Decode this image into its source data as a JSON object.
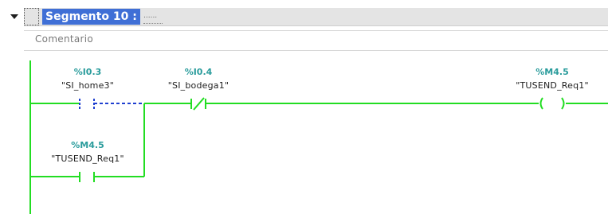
{
  "network": {
    "title": "Segmento 10 :",
    "title_placeholder": "......",
    "comment": "Comentario"
  },
  "colors": {
    "power_flow": "#22dd22",
    "no_power": "#1f3fd0",
    "address": "#2a9c9c",
    "title_highlight": "#3f6fd6"
  },
  "elements": {
    "contact_home": {
      "type": "normally-open-contact",
      "address": "%I0.3",
      "tag": "\"SI_home3\"",
      "state": "not-powered"
    },
    "contact_bodega": {
      "type": "normally-closed-contact",
      "address": "%I0.4",
      "tag": "\"SI_bodega1\"",
      "state": "powered"
    },
    "contact_latch": {
      "type": "normally-open-contact",
      "address": "%M4.5",
      "tag": "\"TUSEND_Req1\"",
      "state": "powered"
    },
    "coil_output": {
      "type": "coil",
      "address": "%M4.5",
      "tag": "\"TUSEND_Req1\"",
      "state": "powered"
    }
  }
}
